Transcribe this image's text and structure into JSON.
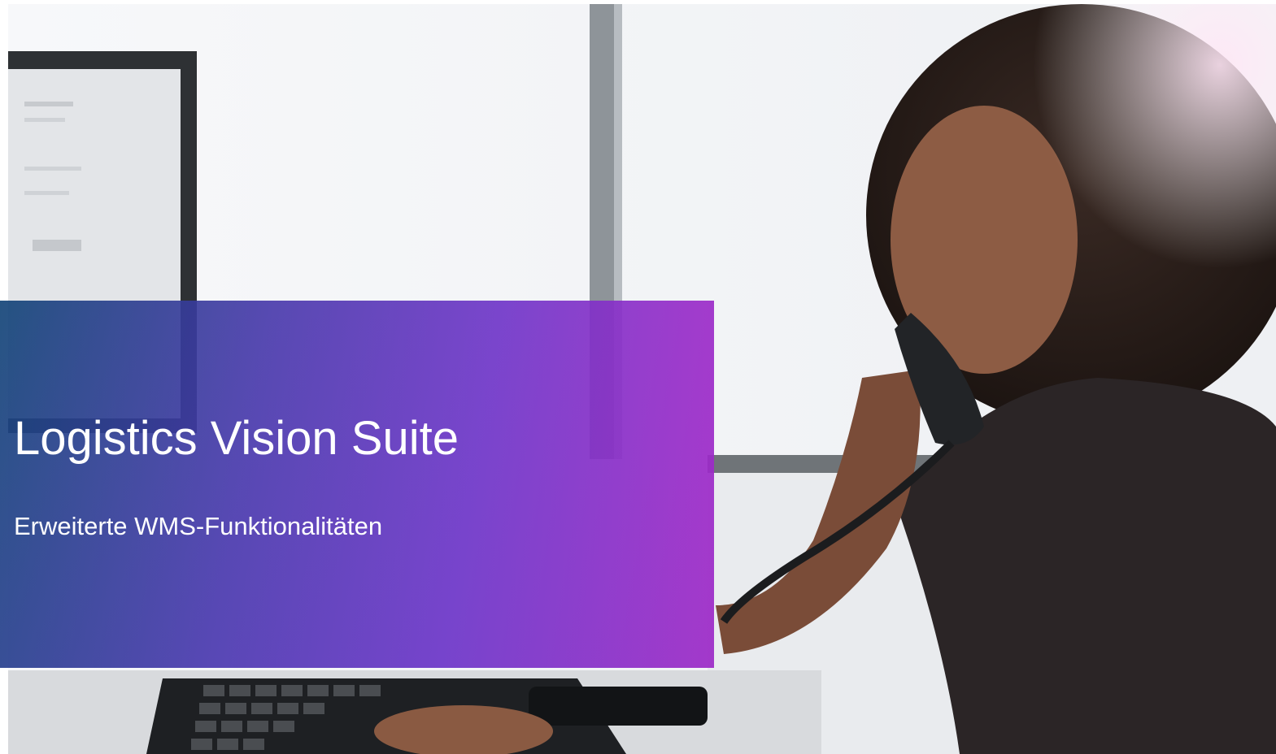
{
  "slide": {
    "title": "Logistics Vision Suite",
    "subtitle": "Erweiterte WMS-Funktionalitäten"
  },
  "photo": {
    "description_icon": "office-photo-woman-on-phone"
  },
  "colors": {
    "band_start": "#144678",
    "band_mid": "#6e32c8",
    "band_end": "#aa28c8",
    "text": "#ffffff"
  }
}
